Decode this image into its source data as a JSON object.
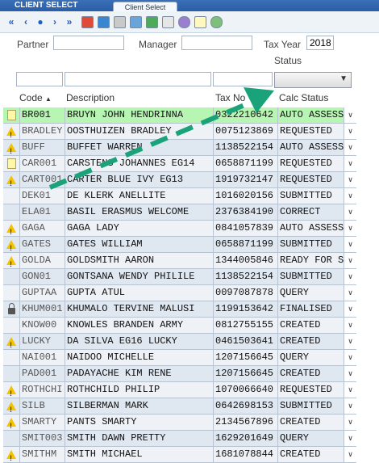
{
  "window": {
    "title": "CLIENT SELECT",
    "tab": "Client Select"
  },
  "toolbar": {
    "icons": [
      "first-page-icon",
      "prev-page-icon",
      "info-icon",
      "next-page-icon",
      "last-page-icon",
      "refresh-icon",
      "filter-icon",
      "print-icon",
      "export-icon",
      "tools-icon",
      "calendar-icon",
      "settings-icon",
      "document-icon",
      "upload-icon"
    ]
  },
  "filters": {
    "partner_label": "Partner",
    "partner_value": "",
    "manager_label": "Manager",
    "manager_value": "",
    "tax_year_label": "Tax Year",
    "tax_year_value": "2018",
    "status_label": "Status",
    "status_value": ""
  },
  "columns": {
    "code": "Code",
    "code_sort": "▲",
    "description": "Description",
    "tax_no": "Tax No",
    "calc_status": "Calc Status"
  },
  "rows": [
    {
      "icon": "note",
      "code": "BR001",
      "desc": "BRUYN JOHN HENDRINNA",
      "tax": "0322210642",
      "status": "AUTO ASSESSED",
      "selected": true
    },
    {
      "icon": "warn",
      "code": "BRADLEY",
      "desc": "OOSTHUIZEN BRADLEY",
      "tax": "0075123869",
      "status": "REQUESTED"
    },
    {
      "icon": "warn",
      "code": "BUFF",
      "desc": "BUFFET WARREN",
      "tax": "1138522154",
      "status": "AUTO ASSESSED"
    },
    {
      "icon": "note",
      "code": "CAR001",
      "desc": "CARSTENS JOHANNES EG14",
      "tax": "0658871199",
      "status": "REQUESTED"
    },
    {
      "icon": "warn",
      "code": "CART001",
      "desc": "CARTER BLUE IVY EG13",
      "tax": "1919732147",
      "status": "REQUESTED"
    },
    {
      "icon": "",
      "code": "DEK01",
      "desc": "DE KLERK ANELLITE",
      "tax": "1016020156",
      "status": "SUBMITTED"
    },
    {
      "icon": "",
      "code": "ELA01",
      "desc": "BASIL ERASMUS WELCOME",
      "tax": "2376384190",
      "status": "CORRECT"
    },
    {
      "icon": "warn",
      "code": "GAGA",
      "desc": "GAGA LADY",
      "tax": "0841057839",
      "status": "AUTO ASSESSED"
    },
    {
      "icon": "warn",
      "code": "GATES",
      "desc": "GATES WILLIAM",
      "tax": "0658871199",
      "status": "SUBMITTED"
    },
    {
      "icon": "warn",
      "code": "GOLDA",
      "desc": "GOLDSMITH AARON",
      "tax": "1344005846",
      "status": "READY FOR SUBMISSION"
    },
    {
      "icon": "",
      "code": "GON01",
      "desc": "GONTSANA WENDY PHILILE",
      "tax": "1138522154",
      "status": "SUBMITTED"
    },
    {
      "icon": "",
      "code": "GUPTAA",
      "desc": "GUPTA ATUL",
      "tax": "0097087878",
      "status": "QUERY"
    },
    {
      "icon": "lock",
      "code": "KHUM001",
      "desc": "KHUMALO TERVINE MALUSI",
      "tax": "1199153642",
      "status": "FINALISED"
    },
    {
      "icon": "",
      "code": "KNOW00",
      "desc": "KNOWLES BRANDEN ARMY",
      "tax": "0812755155",
      "status": "CREATED"
    },
    {
      "icon": "warn",
      "code": "LUCKY",
      "desc": "DA SILVA EG16 LUCKY",
      "tax": "0461503641",
      "status": "CREATED"
    },
    {
      "icon": "",
      "code": "NAI001",
      "desc": "NAIDOO MICHELLE",
      "tax": "1207156645",
      "status": "QUERY"
    },
    {
      "icon": "",
      "code": "PAD001",
      "desc": "PADAYACHE KIM RENE",
      "tax": "1207156645",
      "status": "CREATED"
    },
    {
      "icon": "warn",
      "code": "ROTHCHI",
      "desc": "ROTHCHILD PHILIP",
      "tax": "1070066640",
      "status": "REQUESTED"
    },
    {
      "icon": "warn",
      "code": "SILB",
      "desc": "SILBERMAN MARK",
      "tax": "0642698153",
      "status": "SUBMITTED"
    },
    {
      "icon": "warn",
      "code": "SMARTY",
      "desc": "PANTS SMARTY",
      "tax": "2134567896",
      "status": "CREATED"
    },
    {
      "icon": "",
      "code": "SMIT003",
      "desc": "SMITH DAWN PRETTY",
      "tax": "1629201649",
      "status": "QUERY"
    },
    {
      "icon": "warn",
      "code": "SMITHM",
      "desc": "SMITH MICHAEL",
      "tax": "1681078844",
      "status": "CREATED"
    }
  ],
  "colors": {
    "selected_row": "#b7f5b2",
    "arrow": "#1aa37a",
    "titlebar": "#2a5da6"
  }
}
